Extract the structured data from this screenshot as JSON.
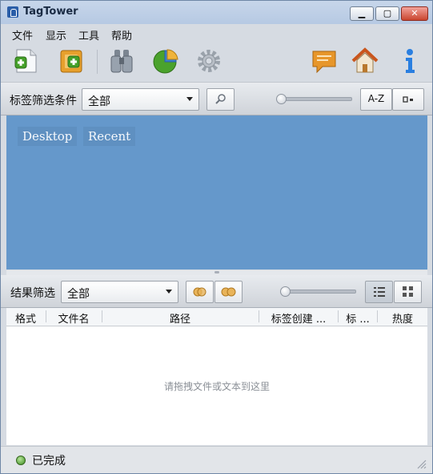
{
  "window": {
    "title": "TagTower"
  },
  "menubar": {
    "items": [
      "文件",
      "显示",
      "工具",
      "帮助"
    ]
  },
  "toolbar": {
    "buttons": [
      "add-file-icon",
      "add-folder-icon",
      "binoculars-icon",
      "pie-chart-icon",
      "gear-icon",
      "comment-icon",
      "home-icon",
      "info-icon"
    ]
  },
  "tag_filter": {
    "label": "标签筛选条件",
    "selected": "全部",
    "sort_label": "A-Z"
  },
  "tags": [
    "Desktop",
    "Recent"
  ],
  "result_filter": {
    "label": "结果筛选",
    "selected": "全部"
  },
  "table": {
    "columns": [
      "格式",
      "文件名",
      "路径",
      "标签创建 ...",
      "标 ...",
      "热度"
    ],
    "empty_text": "请拖拽文件或文本到这里"
  },
  "status": {
    "text": "已完成"
  },
  "colors": {
    "tag_area": "#6598cb",
    "accent": "#2a5ea8"
  }
}
